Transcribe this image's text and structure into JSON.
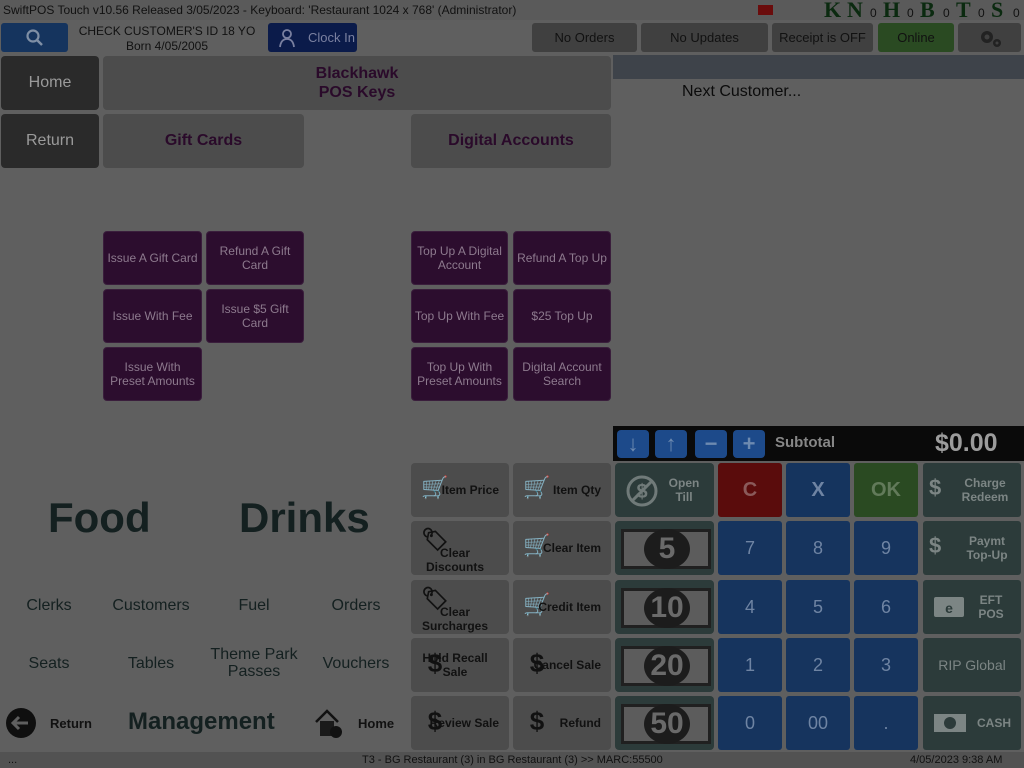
{
  "titlebar": {
    "title": "SwiftPOS Touch  v10.56  Released 3/05/2023 -  Keyboard: 'Restaurant 1024 x 768' (Administrator)",
    "brand_letters": [
      "K",
      "N",
      "H",
      "B",
      "T",
      "S"
    ],
    "brand_digits": [
      "0",
      "0",
      "0",
      "0",
      "0"
    ]
  },
  "header": {
    "search_icon": "search-icon",
    "age_check_line1": "CHECK CUSTOMER'S ID 18 YO",
    "age_check_line2": "Born 4/05/2005",
    "clock_in_label": "Clock In",
    "status_orders": "No Orders",
    "status_updates": "No Updates",
    "status_receipt": "Receipt is OFF",
    "status_online": "Online",
    "settings_icon": "gear-icon"
  },
  "nav": {
    "home": "Home",
    "return": "Return",
    "blackhawk_line1": "Blackhawk",
    "blackhawk_line2": "POS Keys",
    "gift_cards": "Gift Cards",
    "digital_accounts": "Digital Accounts"
  },
  "gift_keys": {
    "issue_gift_card": "Issue A Gift Card",
    "refund_gift_card": "Refund A Gift Card",
    "issue_with_fee": "Issue With Fee",
    "issue_5_gift_card": "Issue $5 Gift Card",
    "issue_with_preset": "Issue With Preset Amounts"
  },
  "digital_keys": {
    "top_up_digital": "Top Up A Digital Account",
    "refund_top_up": "Refund A Top Up",
    "top_up_with_fee": "Top Up With Fee",
    "top_up_25": "$25 Top Up",
    "top_up_preset": "Top Up With Preset Amounts",
    "digital_search": "Digital Account Search"
  },
  "sale_panel": {
    "next_customer": "Next Customer...",
    "subtotal_label": "Subtotal",
    "subtotal_value": "$0.00"
  },
  "categories": {
    "food": "Food",
    "drinks": "Drinks",
    "clerks": "Clerks",
    "customers": "Customers",
    "fuel": "Fuel",
    "orders": "Orders",
    "seats": "Seats",
    "tables": "Tables",
    "theme_park": "Theme Park Passes",
    "vouchers": "Vouchers",
    "return": "Return",
    "management": "Management",
    "home": "Home"
  },
  "item_actions": {
    "item_price": "Item Price",
    "item_qty": "Item Qty",
    "clear_discounts": "Clear Discounts",
    "clear_item": "Clear Item",
    "clear_surcharges": "Clear Surcharges",
    "credit_item": "Credit Item",
    "hold_recall": "Hold Recall Sale",
    "cancel_sale": "Cancel Sale",
    "review_sale": "Review Sale",
    "refund": "Refund"
  },
  "keypad": {
    "open_till": "Open Till",
    "c": "C",
    "x": "X",
    "ok": "OK",
    "charge_redeem": "Charge Redeem",
    "paymt_topup": "Paymt Top-Up",
    "eft_pos": "EFT POS",
    "rip_global": "RIP Global",
    "cash": "CASH",
    "bills": [
      "5",
      "10",
      "20",
      "50"
    ],
    "digits": [
      "7",
      "8",
      "9",
      "4",
      "5",
      "6",
      "1",
      "2",
      "3",
      "0",
      "00",
      "."
    ]
  },
  "footer": {
    "left": "...",
    "center": "T3 - BG Restaurant (3) in BG Restaurant (3) >> MARC:55500",
    "right": "4/05/2023 9:38 AM"
  }
}
